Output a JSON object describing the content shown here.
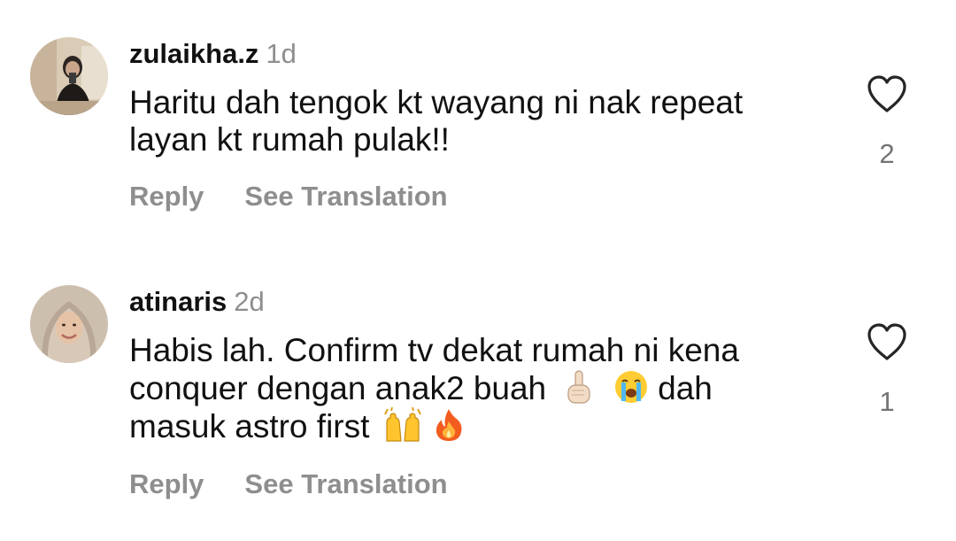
{
  "comments": [
    {
      "username": "zulaikha.z",
      "time": "1d",
      "lines": [
        "Haritu dah tengok kt wayang ni nak repeat",
        "layan kt rumah pulak!!"
      ],
      "reply_label": "Reply",
      "translate_label": "See Translation",
      "like_count": "2",
      "avatar_icon": "user-avatar-photo"
    },
    {
      "username": "atinaris",
      "time": "2d",
      "line1": "Habis lah. Confirm tv dekat rumah ni kena",
      "line2_text": "conquer dengan anak2 buah",
      "line2_emojis": [
        "index-pointing-up-emoji",
        "loudly-crying-face-emoji"
      ],
      "line2_tail": "dah",
      "line3_text": "masuk astro first",
      "line3_emojis": [
        "raising-hands-emoji",
        "fire-emoji"
      ],
      "reply_label": "Reply",
      "translate_label": "See Translation",
      "like_count": "1",
      "avatar_icon": "user-avatar-photo"
    }
  ],
  "colors": {
    "text": "#111111",
    "secondary": "#8e8e8e",
    "icon": "#262626"
  }
}
